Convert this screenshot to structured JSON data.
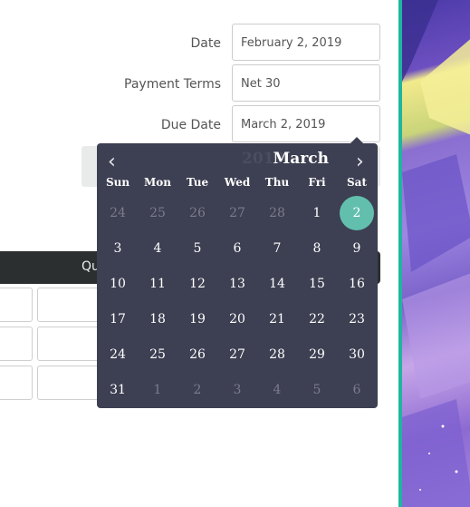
{
  "form": {
    "date_label": "Date",
    "date_value": "February 2, 2019",
    "terms_label": "Payment Terms",
    "terms_value": "Net 30",
    "due_label": "Due Date",
    "due_value": "March 2, 2019"
  },
  "table": {
    "header_text": "Qu"
  },
  "calendar": {
    "month": "March",
    "year": "2019",
    "prev_icon": "chevron-left",
    "next_icon": "chevron-right",
    "weekdays": [
      "Sun",
      "Mon",
      "Tue",
      "Wed",
      "Thu",
      "Fri",
      "Sat"
    ],
    "weeks": [
      [
        {
          "d": "24",
          "m": true
        },
        {
          "d": "25",
          "m": true
        },
        {
          "d": "26",
          "m": true
        },
        {
          "d": "27",
          "m": true
        },
        {
          "d": "28",
          "m": true
        },
        {
          "d": "1"
        },
        {
          "d": "2",
          "sel": true
        }
      ],
      [
        {
          "d": "3"
        },
        {
          "d": "4"
        },
        {
          "d": "5"
        },
        {
          "d": "6"
        },
        {
          "d": "7"
        },
        {
          "d": "8"
        },
        {
          "d": "9"
        }
      ],
      [
        {
          "d": "10"
        },
        {
          "d": "11"
        },
        {
          "d": "12"
        },
        {
          "d": "13"
        },
        {
          "d": "14"
        },
        {
          "d": "15"
        },
        {
          "d": "16"
        }
      ],
      [
        {
          "d": "17"
        },
        {
          "d": "18"
        },
        {
          "d": "19"
        },
        {
          "d": "20"
        },
        {
          "d": "21"
        },
        {
          "d": "22"
        },
        {
          "d": "23"
        }
      ],
      [
        {
          "d": "24"
        },
        {
          "d": "25"
        },
        {
          "d": "26"
        },
        {
          "d": "27"
        },
        {
          "d": "28"
        },
        {
          "d": "29"
        },
        {
          "d": "30"
        }
      ],
      [
        {
          "d": "31"
        },
        {
          "d": "1",
          "m": true
        },
        {
          "d": "2",
          "m": true
        },
        {
          "d": "3",
          "m": true
        },
        {
          "d": "4",
          "m": true
        },
        {
          "d": "5",
          "m": true
        },
        {
          "d": "6",
          "m": true
        }
      ]
    ],
    "colors": {
      "background": "#3d3f52",
      "selected": "#62bfae",
      "muted": "#7b7d8d"
    }
  },
  "colors": {
    "accent_border": "#1fb5a0",
    "dark_bar": "#2c2f30"
  }
}
